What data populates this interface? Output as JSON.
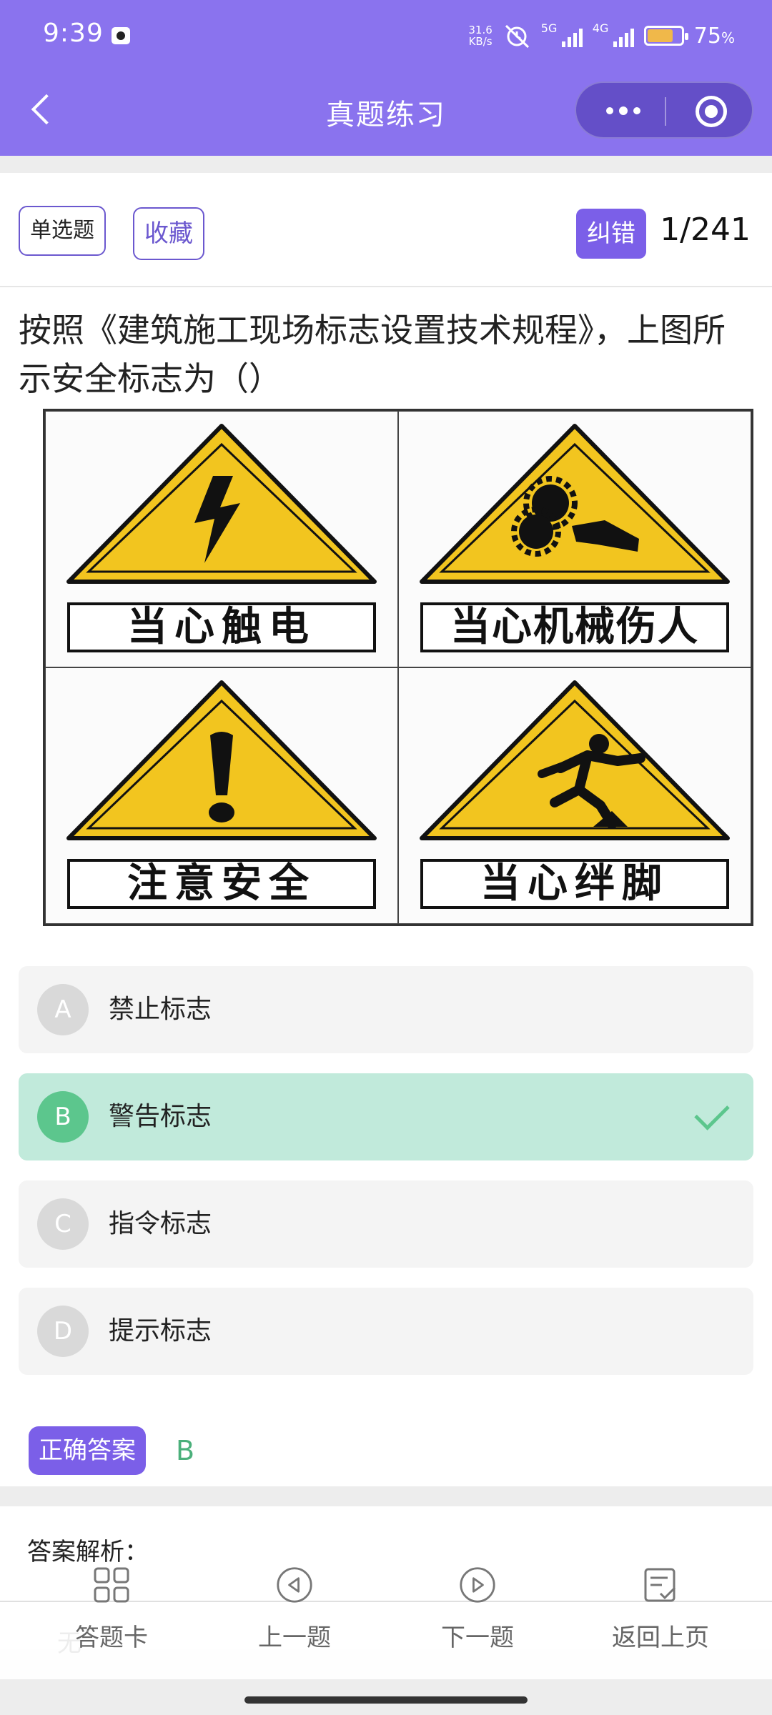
{
  "status": {
    "time": "9:39",
    "net_speed_value": "31.6",
    "net_speed_unit": "KB/s",
    "sig1": "5G",
    "sig2": "4G",
    "battery_percent_value": "75",
    "battery_percent_unit": "%",
    "battery_level": 0.75
  },
  "header": {
    "title": "真题练习"
  },
  "question": {
    "type_tag": "单选题",
    "favorite_label": "收藏",
    "report_label": "纠错",
    "counter": "1/241",
    "text": "按照《建筑施工现场标志设置技术规程》，上图所示安全标志为（）"
  },
  "signs": [
    {
      "caption": "当心触电",
      "icon": "electric-shock-icon"
    },
    {
      "caption": "当心机械伤人",
      "icon": "gear-hand-icon"
    },
    {
      "caption": "注意安全",
      "icon": "exclamation-icon"
    },
    {
      "caption": "当心绊脚",
      "icon": "tripping-person-icon"
    }
  ],
  "options": [
    {
      "letter": "A",
      "text": "禁止标志",
      "state": "normal"
    },
    {
      "letter": "B",
      "text": "警告标志",
      "state": "correct"
    },
    {
      "letter": "C",
      "text": "指令标志",
      "state": "normal"
    },
    {
      "letter": "D",
      "text": "提示标志",
      "state": "normal"
    }
  ],
  "answer": {
    "label": "正确答案",
    "value": "B"
  },
  "analysis": {
    "title": "答案解析：",
    "partial_text": "无"
  },
  "tabbar": [
    {
      "label": "答题卡",
      "icon": "grid-icon"
    },
    {
      "label": "上一题",
      "icon": "prev-circle-icon"
    },
    {
      "label": "下一题",
      "icon": "next-circle-icon"
    },
    {
      "label": "返回上页",
      "icon": "return-doc-icon"
    }
  ],
  "colors": {
    "header_bg": "#8a73ee",
    "accent": "#7b5fe8",
    "correct_bg": "#c1eadb",
    "correct_fg": "#5cc68d",
    "sign_yellow": "#f2c51f"
  }
}
